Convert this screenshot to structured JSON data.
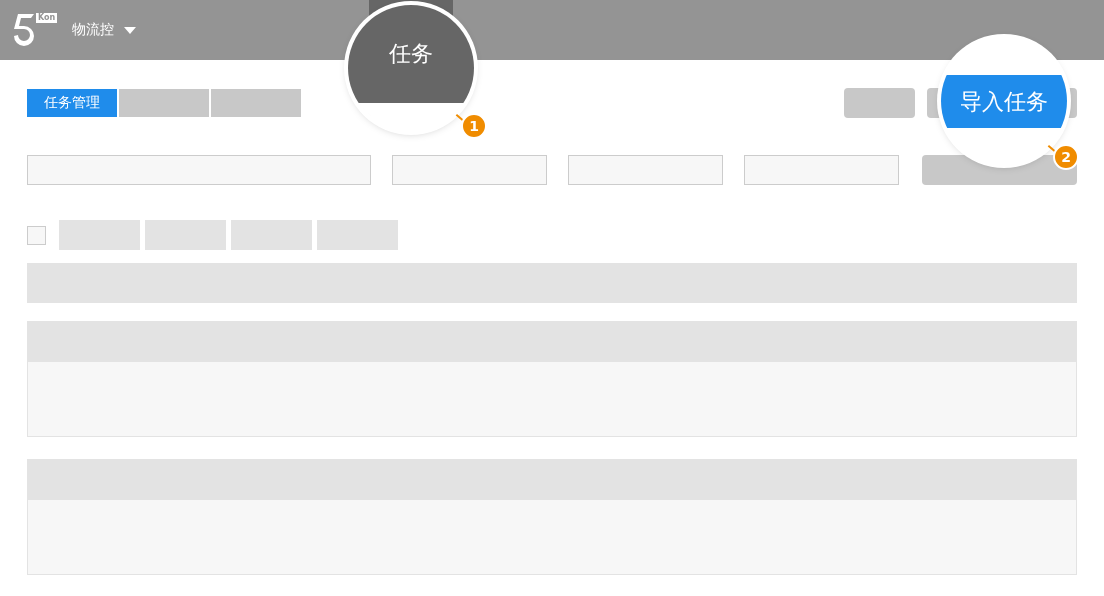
{
  "header": {
    "logo_badge": "Kon",
    "app_menu": "物流控",
    "nav": [
      {
        "selected": true
      }
    ]
  },
  "tabs": [
    {
      "label": "任务管理",
      "selected": true
    },
    {
      "selected": false
    },
    {
      "selected": false
    }
  ],
  "select_all": {
    "checked": false
  },
  "callouts": [
    {
      "kind": "dark",
      "text": "任务",
      "number": "1"
    },
    {
      "kind": "blue",
      "text": "导入任务",
      "number": "2"
    }
  ]
}
